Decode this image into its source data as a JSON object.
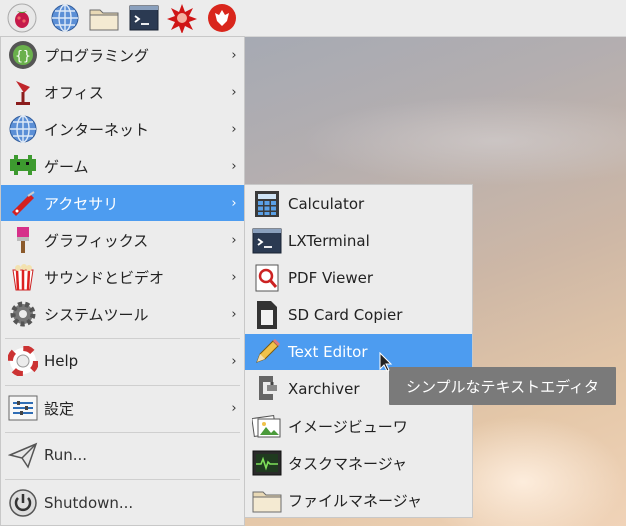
{
  "taskbar": {
    "icons": [
      "raspberry-menu-icon",
      "web-browser-icon",
      "file-manager-icon",
      "terminal-icon",
      "burst-icon",
      "wolfram-icon"
    ]
  },
  "main_menu": {
    "items": [
      {
        "label": "プログラミング",
        "icon": "programming-icon",
        "has_submenu": true
      },
      {
        "label": "オフィス",
        "icon": "office-icon",
        "has_submenu": true
      },
      {
        "label": "インターネット",
        "icon": "internet-icon",
        "has_submenu": true
      },
      {
        "label": "ゲーム",
        "icon": "games-icon",
        "has_submenu": true
      },
      {
        "label": "アクセサリ",
        "icon": "accessories-icon",
        "has_submenu": true,
        "selected": true
      },
      {
        "label": "グラフィックス",
        "icon": "graphics-icon",
        "has_submenu": true
      },
      {
        "label": "サウンドとビデオ",
        "icon": "sound-video-icon",
        "has_submenu": true
      },
      {
        "label": "システムツール",
        "icon": "system-tools-icon",
        "has_submenu": true
      },
      {
        "label": "Help",
        "icon": "help-icon",
        "has_submenu": true
      },
      {
        "label": "設定",
        "icon": "settings-icon",
        "has_submenu": true
      },
      {
        "label": "Run...",
        "icon": "run-icon",
        "has_submenu": false
      },
      {
        "label": "Shutdown...",
        "icon": "shutdown-icon",
        "has_submenu": false
      }
    ],
    "arrow": "›"
  },
  "sub_menu": {
    "items": [
      {
        "label": "Calculator",
        "icon": "calculator-icon"
      },
      {
        "label": "LXTerminal",
        "icon": "terminal-icon"
      },
      {
        "label": "PDF Viewer",
        "icon": "pdf-viewer-icon"
      },
      {
        "label": "SD Card Copier",
        "icon": "sd-card-icon"
      },
      {
        "label": "Text Editor",
        "icon": "text-editor-icon",
        "selected": true
      },
      {
        "label": "Xarchiver",
        "icon": "archiver-icon"
      },
      {
        "label": "イメージビューワ",
        "icon": "image-viewer-icon"
      },
      {
        "label": "タスクマネージャ",
        "icon": "task-manager-icon"
      },
      {
        "label": "ファイルマネージャ",
        "icon": "file-manager-icon"
      }
    ]
  },
  "tooltip": {
    "text": "シンプルなテキストエディタ"
  },
  "colors": {
    "selection": "#4d9cf0",
    "menu_bg": "#ececec",
    "tooltip_bg": "#7a7a7a"
  }
}
